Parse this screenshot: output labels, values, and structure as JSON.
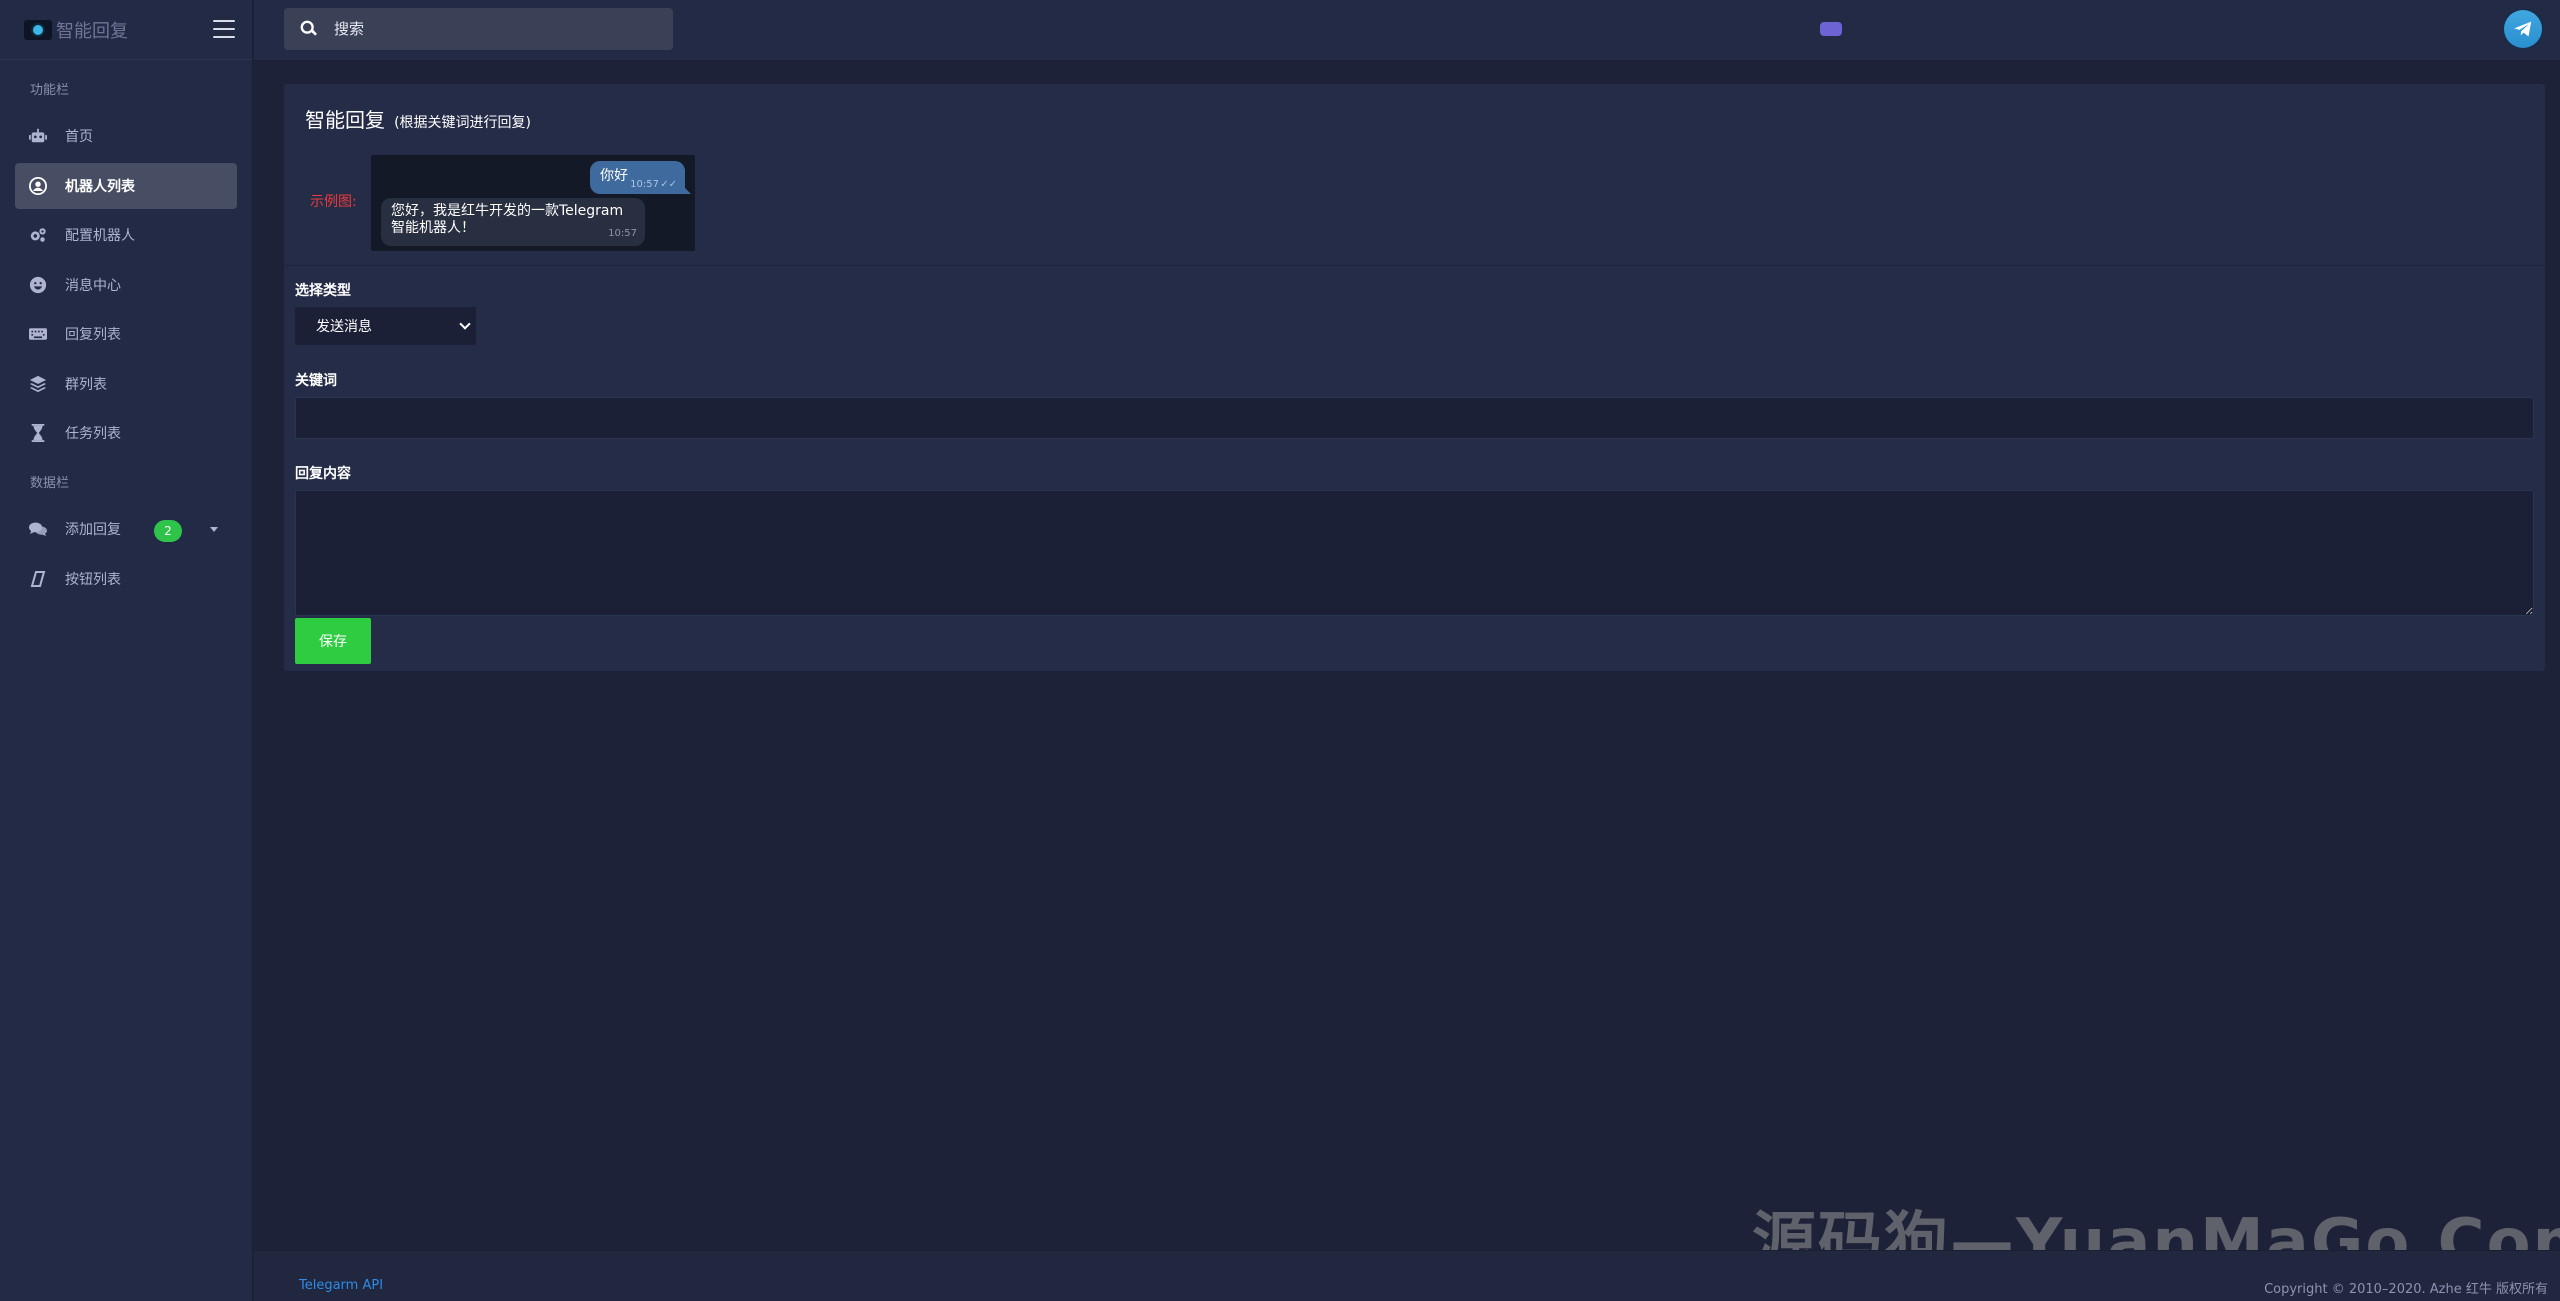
{
  "app": {
    "brand": "智能回复"
  },
  "sidebar": {
    "section1": "功能栏",
    "section2": "数据栏",
    "items": [
      {
        "label": "首页",
        "icon": "robot-icon"
      },
      {
        "label": "机器人列表",
        "icon": "user-circle-icon",
        "active": true
      },
      {
        "label": "配置机器人",
        "icon": "gears-icon"
      },
      {
        "label": "消息中心",
        "icon": "smile-icon"
      },
      {
        "label": "回复列表",
        "icon": "keyboard-icon"
      },
      {
        "label": "群列表",
        "icon": "layers-icon"
      },
      {
        "label": "任务列表",
        "icon": "hourglass-icon"
      }
    ],
    "data_items": [
      {
        "label": "添加回复",
        "icon": "comments-icon",
        "badge": "2"
      },
      {
        "label": "按钮列表",
        "icon": "parallelogram-icon"
      }
    ]
  },
  "topbar": {
    "search_placeholder": "搜索"
  },
  "card": {
    "title": "智能回复",
    "subtitle": "(根据关键词进行回复)",
    "example_label": "示例图:",
    "chat": {
      "out_text": "你好",
      "out_time": "10:57",
      "in_text": "您好，我是红牛开发的一款Telegram智能机器人！",
      "in_time": "10:57"
    },
    "type_label": "选择类型",
    "type_value": "发送消息",
    "keyword_label": "关键词",
    "content_label": "回复内容",
    "save_label": "保存"
  },
  "footer": {
    "api_link": "Telegarm API",
    "copyright": "Copyright © 2010–2020. Azhe 红牛 版权所有"
  },
  "watermark": "源码狗—YuanMaGo.Com",
  "colors": {
    "accent_green": "#2ecc40",
    "badge_green": "#2ec44a",
    "link_blue": "#2f8ce6",
    "bg": "#1e2238",
    "sidebar_bg": "#222a45"
  }
}
